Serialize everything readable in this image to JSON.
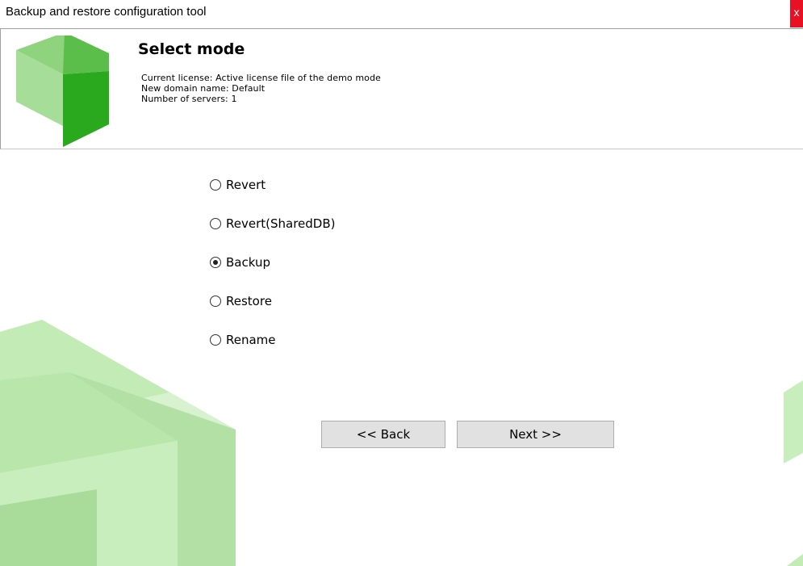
{
  "window": {
    "title": "Backup and restore configuration tool",
    "close_label": "x"
  },
  "header": {
    "title": "Select mode",
    "current_license": "Current license: Active license file of the demo mode",
    "domain_name": "New domain name: Default",
    "servers": "Number of servers: 1"
  },
  "modes": [
    {
      "label": "Revert",
      "selected": false
    },
    {
      "label": "Revert(SharedDB)",
      "selected": false
    },
    {
      "label": "Backup",
      "selected": true
    },
    {
      "label": "Restore",
      "selected": false
    },
    {
      "label": "Rename",
      "selected": false
    }
  ],
  "buttons": {
    "back_label": "<< Back",
    "next_label": "Next >>"
  },
  "colors": {
    "brand_green_dark": "#2aa81e",
    "brand_green_mid": "#5cbe4a",
    "brand_green_light": "#8fd37e",
    "background_green": "#cdeec4"
  }
}
